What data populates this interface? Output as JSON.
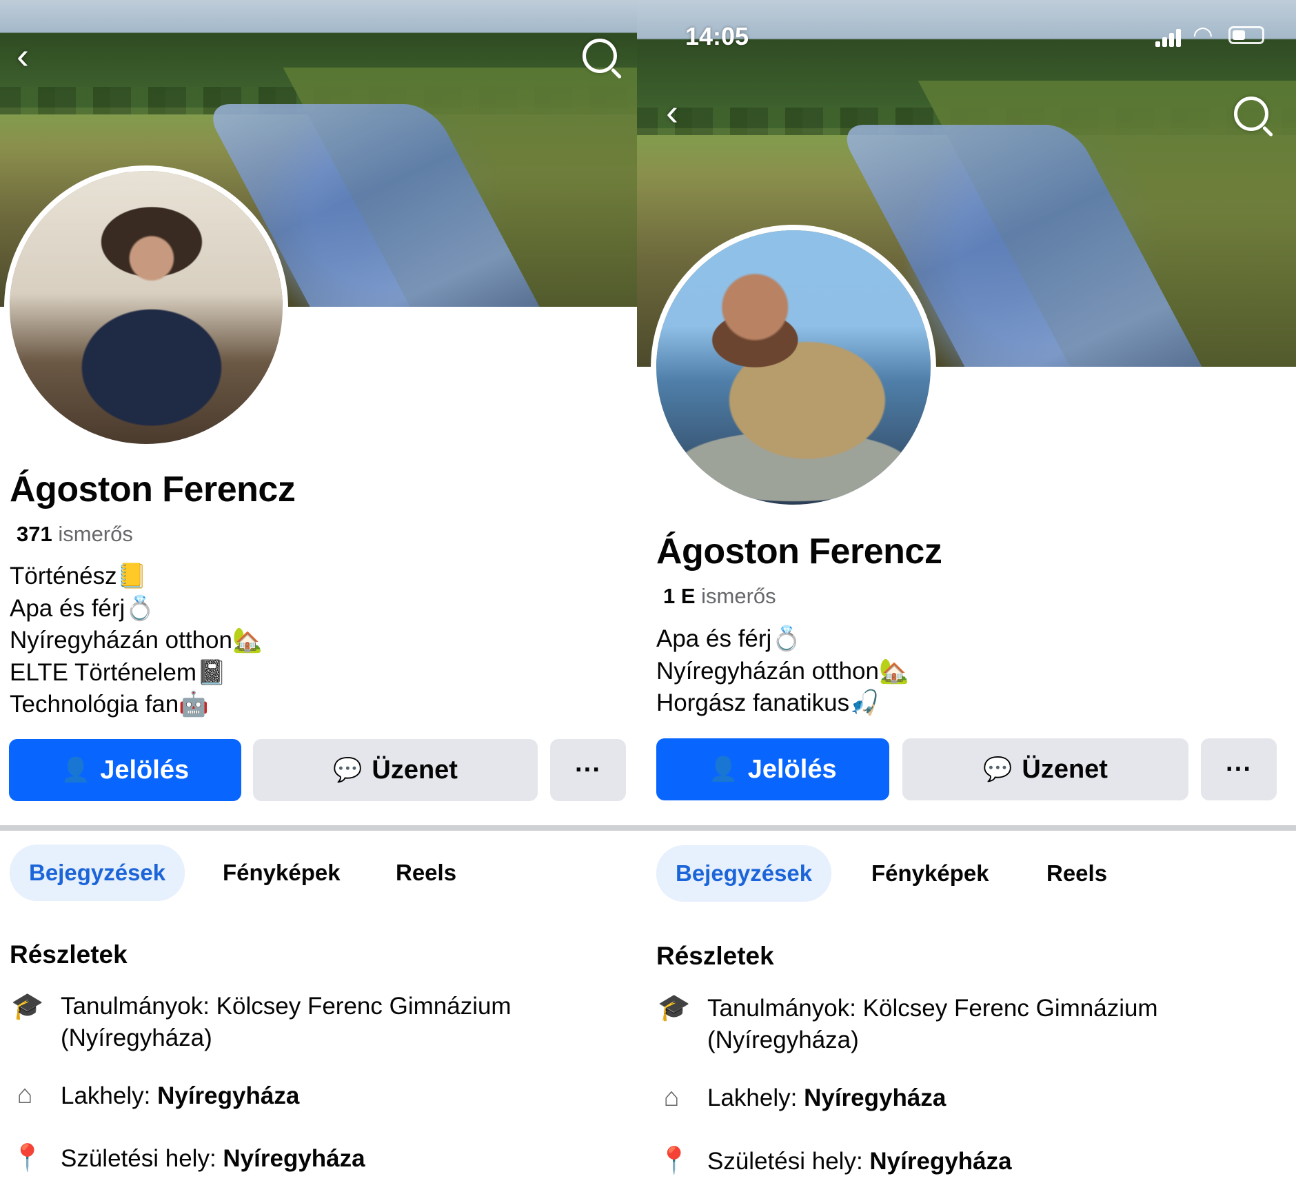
{
  "left": {
    "profile_name": "Ágoston Ferencz",
    "friends_count": "371",
    "friends_label": "ismerős",
    "bio": [
      "Történész📒",
      "Apa és férj💍",
      "Nyíregyházán otthon🏡",
      "ELTE Történelem📓",
      "Technológia fan🤖"
    ],
    "buttons": {
      "add_friend": "Jelölés",
      "message": "Üzenet",
      "more": "···"
    },
    "tabs": [
      "Bejegyzések",
      "Fényképek",
      "Reels"
    ],
    "details_title": "Részletek",
    "details": {
      "studies_label": "Tanulmányok: Kölcsey Ferenc Gimnázium",
      "studies_label_2": "(Nyíregyháza)",
      "residence_label": "Lakhely: ",
      "residence_value": "Nyíregyháza",
      "birthplace_label": "Születési hely: ",
      "birthplace_value": "Nyíregyháza"
    }
  },
  "right": {
    "status_time": "14:05",
    "profile_name": "Ágoston Ferencz",
    "friends_count": "1 E",
    "friends_label": "ismerős",
    "bio": [
      "Apa és férj💍",
      "Nyíregyházán otthon🏡",
      "Horgász fanatikus🎣"
    ],
    "buttons": {
      "add_friend": "Jelölés",
      "message": "Üzenet",
      "more": "···"
    },
    "tabs": [
      "Bejegyzések",
      "Fényképek",
      "Reels"
    ],
    "details_title": "Részletek",
    "details": {
      "studies_label": "Tanulmányok: Kölcsey Ferenc Gimnázium",
      "studies_label_2": "(Nyíregyháza)",
      "residence_label": "Lakhely: ",
      "residence_value": "Nyíregyháza",
      "birthplace_label": "Születési hely: ",
      "birthplace_value": "Nyíregyháza"
    }
  },
  "icons": {
    "back": "chevron-left-icon",
    "search": "search-icon",
    "add_friend": "add-friend-icon",
    "messenger": "messenger-icon",
    "studies": "graduation-cap-icon",
    "residence": "home-icon",
    "birthplace": "location-pin-icon"
  },
  "colors": {
    "primary": "#0866ff",
    "secondary_button": "#e4e6eb",
    "active_tab_bg": "#e7f0fd",
    "active_tab_text": "#1b65d8",
    "muted_text": "#65676b"
  }
}
